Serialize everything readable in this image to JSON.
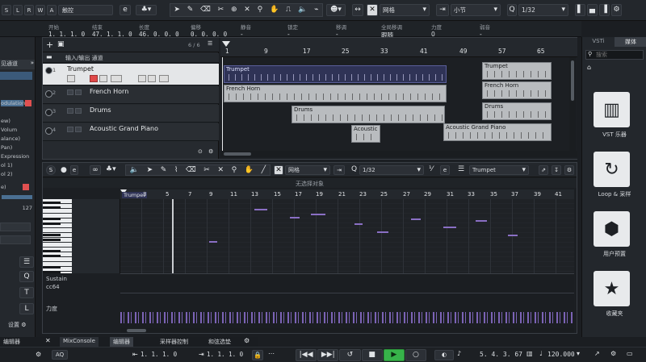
{
  "toolbar": {
    "mode_letters": [
      "S",
      "L",
      "R",
      "W",
      "A"
    ],
    "touch_mode": "触控",
    "grid_type": "网格",
    "quantize_type": "小节",
    "quantize_value": "1/32"
  },
  "infobar": {
    "columns": [
      {
        "label": "开始",
        "value": "1. 1. 1. 0"
      },
      {
        "label": "结束",
        "value": "47. 1. 1. 0"
      },
      {
        "label": "长度",
        "value": "46. 0. 0. 0"
      },
      {
        "label": "偏移",
        "value": "0. 0. 0. 0"
      },
      {
        "label": "静音",
        "value": "-"
      },
      {
        "label": "锁定",
        "value": "-"
      },
      {
        "label": "移调",
        "value": "-"
      },
      {
        "label": "全局移调",
        "value": "跟随"
      },
      {
        "label": "力度",
        "value": "0"
      },
      {
        "label": "弱音",
        "value": "-"
      }
    ]
  },
  "inspector": {
    "header": "见通道",
    "items": [
      "odulation)",
      "ew)",
      "Volum",
      "alance)",
      "Pan)",
      "Expression",
      "ol 1)",
      "ol 2)"
    ],
    "value_a": "127",
    "value_b": "e)",
    "settings_label": "设置",
    "editor_label": "编辑器",
    "tools": [
      "Q",
      "T",
      "L"
    ]
  },
  "project": {
    "page_counter": "6 / 6",
    "folder_label": "输入/输出 通道",
    "tracks": [
      {
        "num": "1",
        "name": "Trumpet"
      },
      {
        "num": "2",
        "name": "French Horn"
      },
      {
        "num": "3",
        "name": "Drums"
      },
      {
        "num": "4",
        "name": "Acoustic Grand Piano"
      }
    ],
    "ruler": [
      "1",
      "9",
      "17",
      "25",
      "33",
      "41",
      "49",
      "57",
      "65"
    ],
    "events": [
      {
        "name": "Trumpet",
        "track": 0
      },
      {
        "name": "Trumpet",
        "track": 0
      },
      {
        "name": "French Horn",
        "track": 1
      },
      {
        "name": "French Horn",
        "track": 1
      },
      {
        "name": "Drums",
        "track": 2
      },
      {
        "name": "Drums",
        "track": 2
      },
      {
        "name": "Acoustic Gr...",
        "track": 3
      },
      {
        "name": "Acoustic Grand Piano",
        "track": 3
      }
    ]
  },
  "keyeditor": {
    "grid_type": "网格",
    "quantize_value": "1/32",
    "track_select": "Trumpet",
    "no_selection": "无选择对象",
    "part_label": "Trumpet",
    "ruler": [
      "3",
      "5",
      "7",
      "9",
      "11",
      "13",
      "15",
      "17",
      "19",
      "21",
      "23",
      "25",
      "27",
      "29",
      "31",
      "33",
      "35",
      "37",
      "39",
      "41"
    ],
    "lanes": [
      {
        "label": "Sustain"
      },
      {
        "label": "cc64"
      },
      {
        "label": "力度"
      }
    ]
  },
  "rightpanel": {
    "tabs": [
      "VSTi",
      "媒体"
    ],
    "search_placeholder": "搜索",
    "tiles": [
      {
        "label": "VST 乐器",
        "icon": "piano-keys-icon"
      },
      {
        "label": "Loop & 采样",
        "icon": "loop-icon"
      },
      {
        "label": "用户预置",
        "icon": "user-preset-icon"
      },
      {
        "label": "收藏夹",
        "icon": "star-icon"
      }
    ]
  },
  "bottom_tabs": [
    "MixConsole",
    "编辑器",
    "采样器控制",
    "和弦选垫"
  ],
  "transport": {
    "aq_label": "AQ",
    "left_locator": "1. 1. 1.   0",
    "right_locator": "1. 1. 1.   0",
    "position": "5. 4. 3. 67",
    "tempo": "120.000"
  }
}
